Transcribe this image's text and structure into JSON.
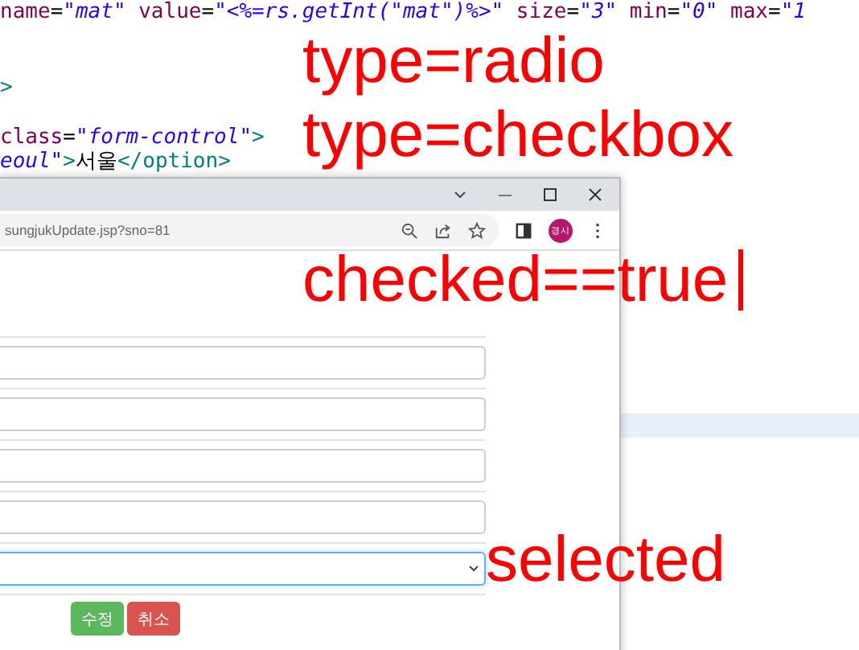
{
  "editor": {
    "lines": [
      {
        "kind": "code",
        "parts": [
          {
            "kind": "attr",
            "text": "name"
          },
          {
            "kind": "plain",
            "text": "="
          },
          {
            "kind": "string",
            "text": "\"mat\""
          },
          {
            "kind": "attr",
            "text": " value"
          },
          {
            "kind": "plain",
            "text": "="
          },
          {
            "kind": "string",
            "text": "\"<%=rs.getInt(\"mat\")%>\""
          },
          {
            "kind": "attr",
            "text": " size"
          },
          {
            "kind": "plain",
            "text": "="
          },
          {
            "kind": "string",
            "text": "\"3\""
          },
          {
            "kind": "attr",
            "text": " min"
          },
          {
            "kind": "plain",
            "text": "="
          },
          {
            "kind": "string",
            "text": "\"0\""
          },
          {
            "kind": "attr",
            "text": " max"
          },
          {
            "kind": "plain",
            "text": "="
          },
          {
            "kind": "string",
            "text": "\"1"
          }
        ]
      },
      {
        "kind": "blank"
      },
      {
        "kind": "blank"
      },
      {
        "kind": "code",
        "parts": [
          {
            "kind": "tag",
            "text": ">"
          }
        ]
      },
      {
        "kind": "blank"
      },
      {
        "kind": "code",
        "parts": [
          {
            "kind": "attr",
            "text": "class"
          },
          {
            "kind": "plain",
            "text": "="
          },
          {
            "kind": "string",
            "text": "\"form-control\""
          },
          {
            "kind": "tag",
            "text": ">"
          }
        ]
      },
      {
        "kind": "code",
        "parts": [
          {
            "kind": "string",
            "text": "eoul\""
          },
          {
            "kind": "tag",
            "text": ">"
          },
          {
            "kind": "plain",
            "text": "서울"
          },
          {
            "kind": "tag",
            "text": "</option>"
          }
        ]
      }
    ]
  },
  "browser": {
    "url": "sungjukUpdate.jsp?sno=81",
    "profile": "경시",
    "fields": [
      {
        "kind": "input",
        "focused": false
      },
      {
        "kind": "input",
        "focused": false
      },
      {
        "kind": "input",
        "focused": false
      },
      {
        "kind": "input",
        "focused": false
      },
      {
        "kind": "select",
        "focused": true
      }
    ],
    "buttons": [
      {
        "label": "수정",
        "kind": "success"
      },
      {
        "label": "취소",
        "kind": "danger"
      }
    ]
  },
  "annotations": [
    {
      "text": "type=radio",
      "caret": false
    },
    {
      "text": "type=checkbox",
      "caret": false
    },
    {
      "text": "checked==true",
      "caret": true
    },
    {
      "text": "selected",
      "caret": false
    }
  ]
}
